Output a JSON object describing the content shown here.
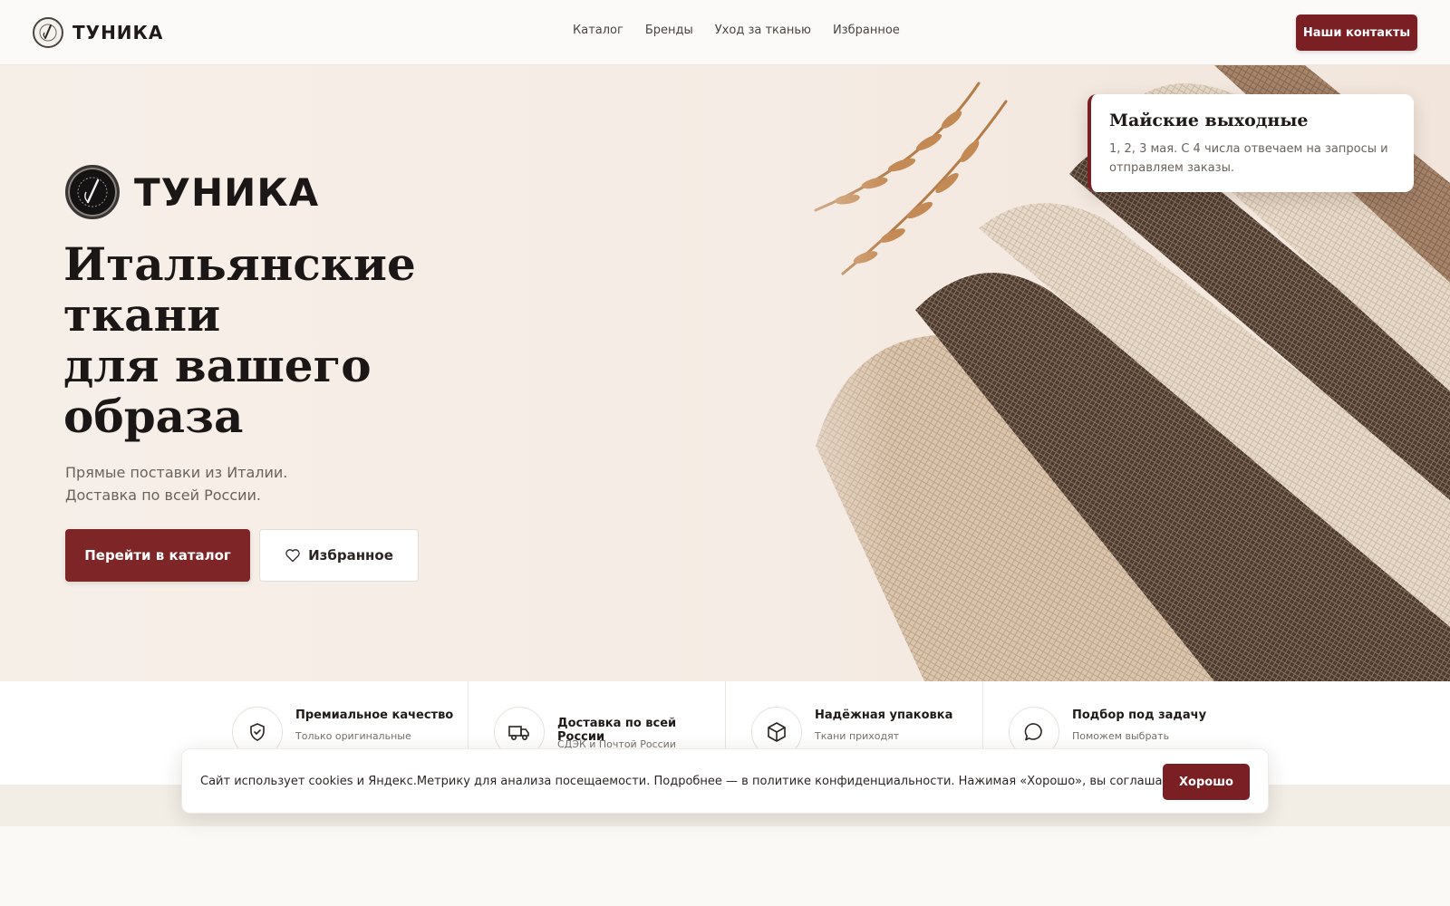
{
  "header": {
    "brand": "ТУНИКА",
    "nav": [
      "Каталог",
      "Бренды",
      "Уход за тканью",
      "Избранное"
    ],
    "contact_button": "Наши контакты"
  },
  "hero": {
    "brand": "ТУНИКА",
    "title_lines": [
      "Итальянские",
      "ткани",
      "для вашего",
      "образа"
    ],
    "subtitle_lines": [
      "Прямые поставки из Италии.",
      "Доставка по всей России."
    ],
    "primary_button": "Перейти в каталог",
    "secondary_button": "Избранное"
  },
  "notice": {
    "title": "Майские выходные",
    "text": "1, 2, 3 мая. С 4 числа отвечаем на запросы и отправляем заказы."
  },
  "features": [
    {
      "icon": "shield-check-icon",
      "title": "Премиальное качество",
      "desc": "Только оригинальные"
    },
    {
      "icon": "truck-icon",
      "title": "Доставка по всей России",
      "desc": "СДЭК и Почтой России"
    },
    {
      "icon": "box-icon",
      "title": "Надёжная упаковка",
      "desc": "Ткани приходят"
    },
    {
      "icon": "chat-bubble-icon",
      "title": "Подбор под задачу",
      "desc": "Поможем выбрать"
    }
  ],
  "cookie": {
    "text": "Сайт использует cookies и Яндекс.Метрику для анализа посещаемости. Подробнее — в политике конфиденциальности. Нажимая «Хорошо», вы соглашаетесь.",
    "button": "Хорошо"
  },
  "colors": {
    "accent": "#7a1f23",
    "background": "#fbf9f6",
    "hero_background": "#f5ece5"
  }
}
